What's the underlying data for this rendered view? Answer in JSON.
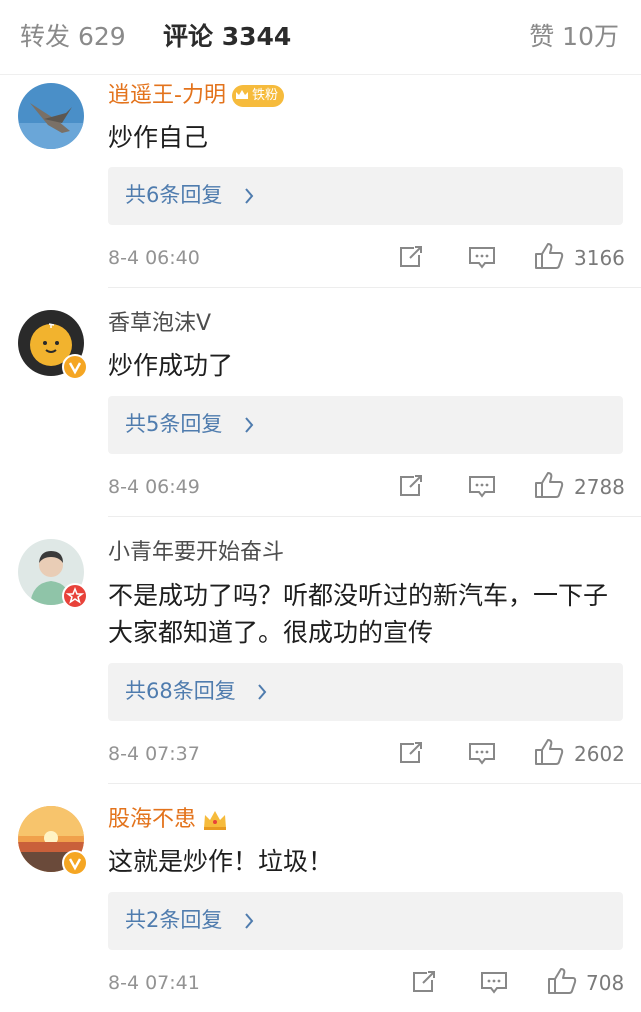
{
  "tabs": {
    "repost": "转发 629",
    "comments": "评论 3344",
    "likes": "赞 10万"
  },
  "comments": [
    {
      "username": "逍遥王-力明",
      "fan_badge": "铁粉",
      "text": "炒作自己",
      "replies": "共6条回复",
      "time": "8-4 06:40",
      "likes": "3166"
    },
    {
      "username": "香草泡沫V",
      "text": "炒作成功了",
      "replies": "共5条回复",
      "time": "8-4 06:49",
      "likes": "2788"
    },
    {
      "username": "小青年要开始奋斗",
      "text": "不是成功了吗？听都没听过的新汽车，一下子大家都知道了。很成功的宣传",
      "replies": "共68条回复",
      "time": "8-4 07:37",
      "likes": "2602"
    },
    {
      "username": "股海不患",
      "text": "这就是炒作！垃圾！",
      "replies": "共2条回复",
      "time": "8-4 07:41",
      "likes": "708"
    }
  ],
  "colors": {
    "link": "#4f7cae",
    "vip_name": "#e3731c",
    "verified": "#f5a623",
    "star_badge": "#e8423a"
  },
  "icons": [
    "repost-icon",
    "comment-icon",
    "like-icon",
    "chevron-right-icon",
    "crown-icon",
    "verified-v-icon"
  ]
}
